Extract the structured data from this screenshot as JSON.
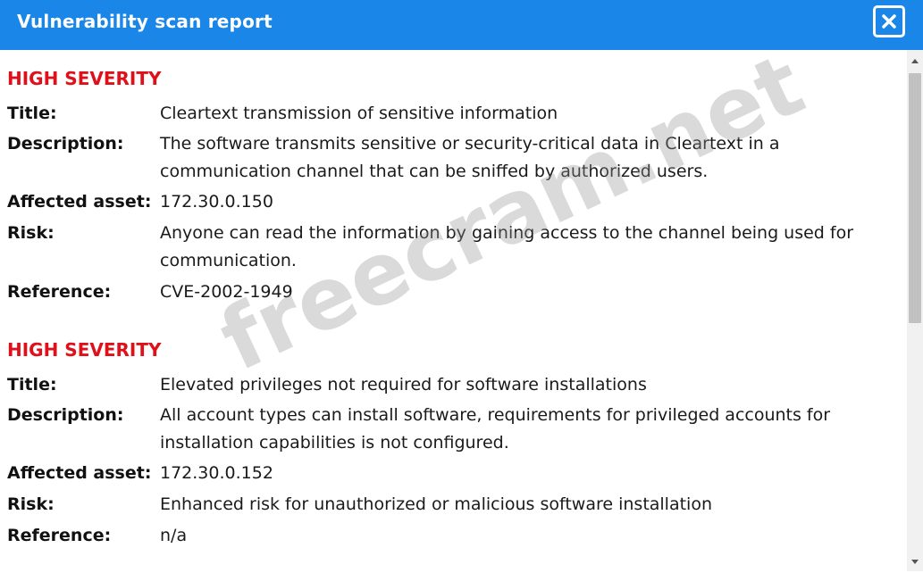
{
  "window": {
    "title": "Vulnerability scan report",
    "close_icon": "close-icon"
  },
  "findings": [
    {
      "severity": "HIGH SEVERITY",
      "title_label": "Title:",
      "title": "Cleartext transmission of sensitive information",
      "description_label": "Description:",
      "description": "The software transmits sensitive or security-critical data in Cleartext in a communication channel that can be sniffed by authorized users.",
      "asset_label": "Affected asset:",
      "asset": "172.30.0.150",
      "risk_label": "Risk:",
      "risk": "Anyone can read the information by gaining access to the channel being used for communication.",
      "reference_label": "Reference:",
      "reference": "CVE-2002-1949"
    },
    {
      "severity": "HIGH SEVERITY",
      "title_label": "Title:",
      "title": "Elevated privileges not required for software installations",
      "description_label": "Description:",
      "description": "All account types can install software, requirements for privileged accounts for installation capabilities is not configured.",
      "asset_label": "Affected asset:",
      "asset": "172.30.0.152",
      "risk_label": "Risk:",
      "risk": "Enhanced risk for unauthorized or malicious software installation",
      "reference_label": "Reference:",
      "reference": "n/a"
    }
  ],
  "watermark": "freecram.net",
  "colors": {
    "titlebar": "#1a86e8",
    "severity": "#e0101a"
  }
}
